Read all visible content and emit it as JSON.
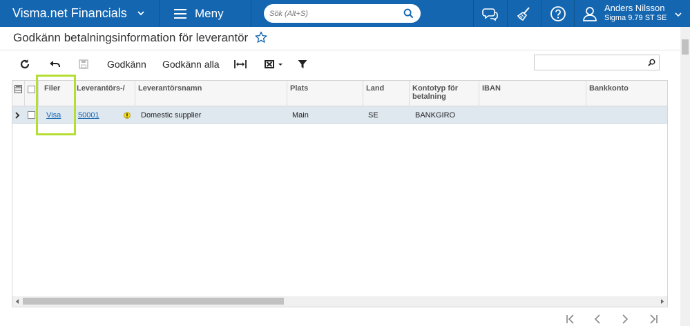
{
  "topbar": {
    "brand": "Visma.net Financials",
    "menu_label": "Meny",
    "search_placeholder": "Sök (Alt+S)",
    "user_name": "Anders Nilsson",
    "user_company": "Sigma 9.79 ST SE",
    "icons": [
      "chat-icon",
      "broom-icon",
      "help-icon",
      "user-icon"
    ]
  },
  "page": {
    "title": "Godkänn betalningsinformation för leverantör"
  },
  "toolbar": {
    "approve_label": "Godkänn",
    "approve_all_label": "Godkänn alla"
  },
  "grid": {
    "columns": [
      "Filer",
      "Leverantörs-/",
      "Leverantörsnamn",
      "Plats",
      "Land",
      "Kontotyp för betalning",
      "IBAN",
      "Bankkonto"
    ],
    "rows": [
      {
        "files": "Visa",
        "vendor_id": "50001",
        "vendor_name": "Domestic supplier",
        "location": "Main",
        "country": "SE",
        "account_type": "BANKGIRO",
        "iban": "",
        "bank_account": ""
      }
    ]
  },
  "colors": {
    "topbar": "#1466b1",
    "highlight": "#b4de32",
    "row_selected": "#dfe7ef"
  }
}
